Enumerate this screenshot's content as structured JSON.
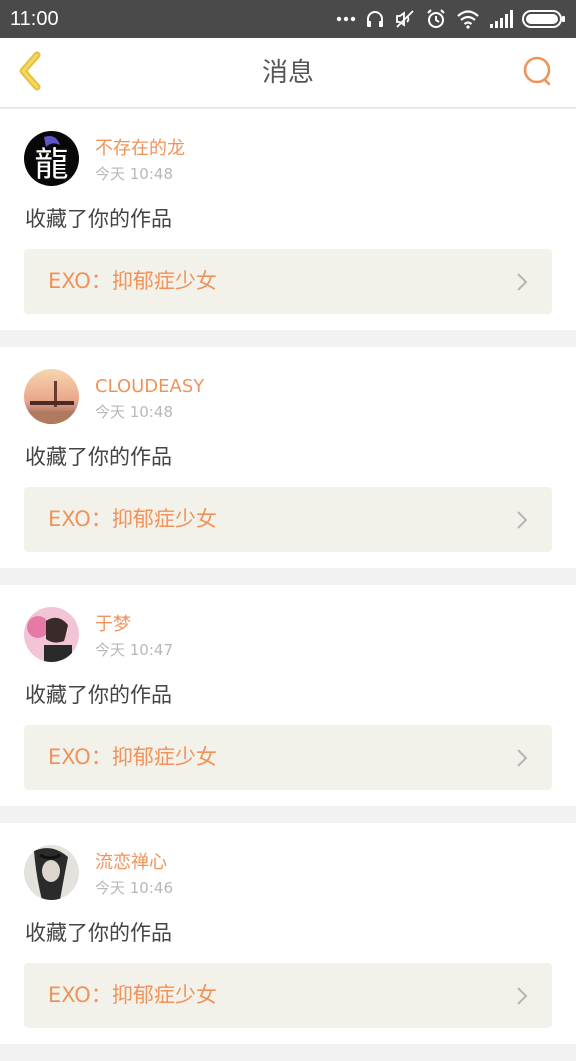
{
  "status_bar": {
    "time": "11:00",
    "icons": [
      "more-icon",
      "headphones-icon",
      "mute-icon",
      "alarm-icon",
      "wifi-icon",
      "signal-icon",
      "battery-icon"
    ]
  },
  "nav": {
    "title": "消息",
    "back_icon": "chevron-left-icon",
    "search_icon": "search-icon",
    "accent": "#f0935a"
  },
  "messages": [
    {
      "username": "不存在的龙",
      "time": "今天 10:48",
      "action": "收藏了你的作品",
      "work_title": "EXO：抑郁症少女",
      "avatar_text": "龍"
    },
    {
      "username": "CLOUDEASY",
      "time": "今天 10:48",
      "action": "收藏了你的作品",
      "work_title": "EXO：抑郁症少女"
    },
    {
      "username": "于梦",
      "time": "今天 10:47",
      "action": "收藏了你的作品",
      "work_title": "EXO：抑郁症少女"
    },
    {
      "username": "流恋禅心",
      "time": "今天 10:46",
      "action": "收藏了你的作品",
      "work_title": "EXO：抑郁症少女"
    }
  ]
}
